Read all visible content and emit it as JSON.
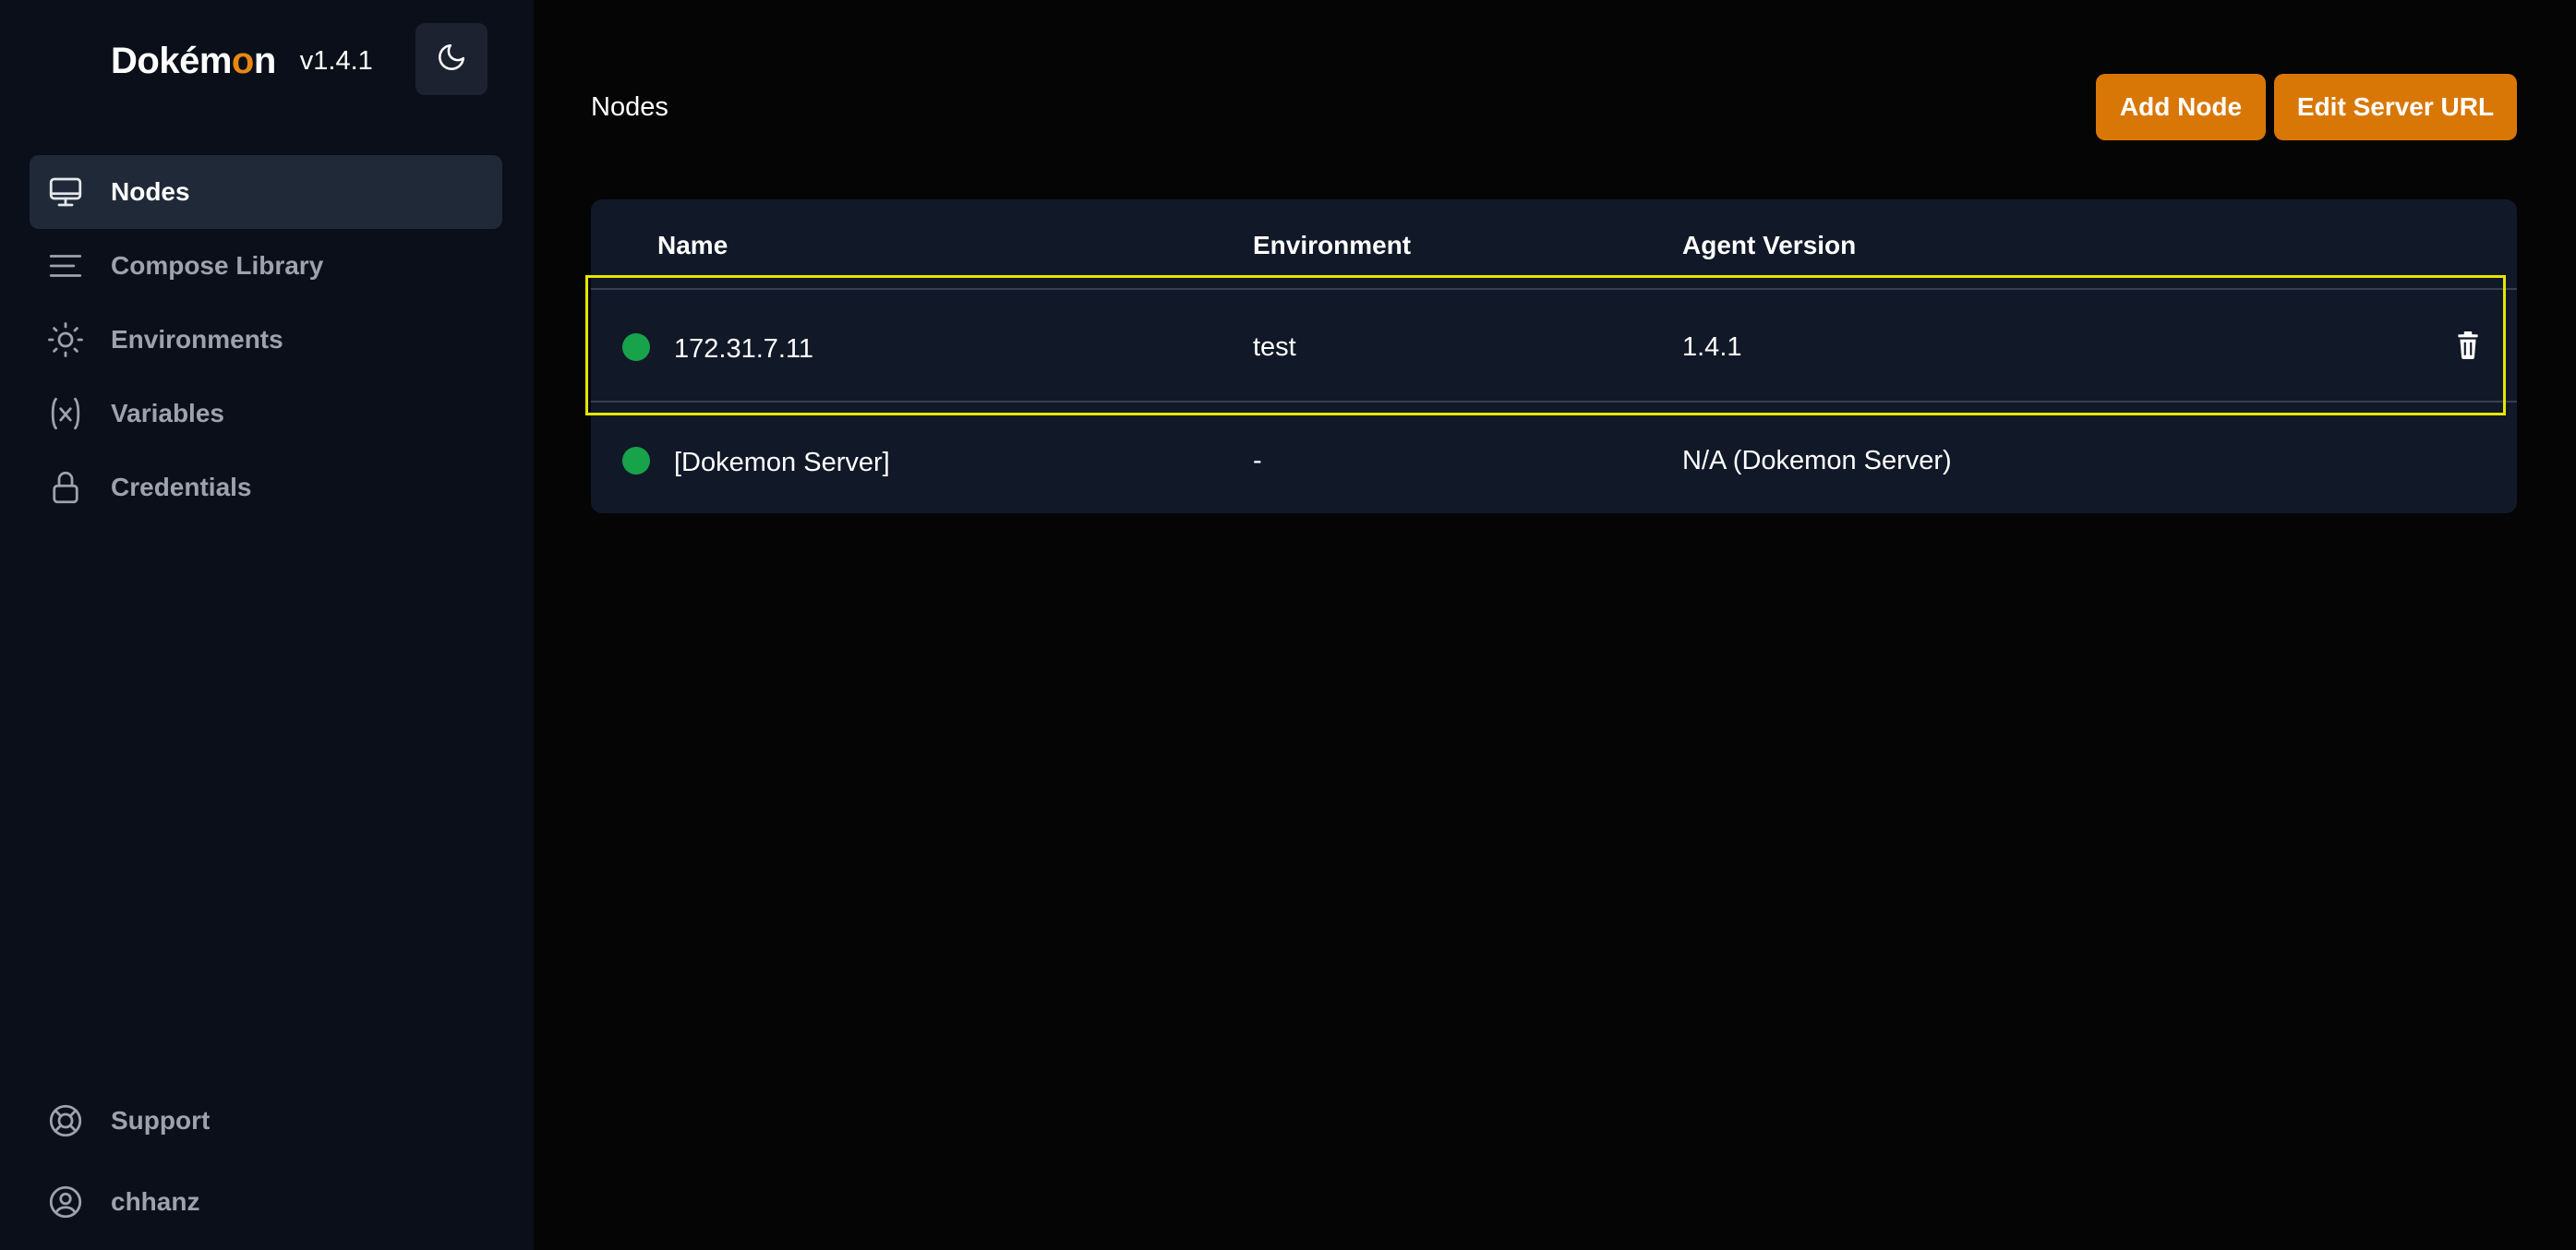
{
  "app": {
    "brand_prefix": "Dok",
    "brand_accent_char": "é",
    "brand_mid": "m",
    "brand_accent_o": "o",
    "brand_suffix": "n",
    "version": "v1.4.1"
  },
  "theme_toggle": {
    "icon": "moon-icon"
  },
  "sidebar": {
    "items": [
      {
        "label": "Nodes",
        "icon": "monitor-icon",
        "active": true
      },
      {
        "label": "Compose Library",
        "icon": "lines-icon",
        "active": false
      },
      {
        "label": "Environments",
        "icon": "sun-icon",
        "active": false
      },
      {
        "label": "Variables",
        "icon": "function-x-icon",
        "active": false
      },
      {
        "label": "Credentials",
        "icon": "lock-icon",
        "active": false
      }
    ],
    "bottom_items": [
      {
        "label": "Support",
        "icon": "lifebuoy-icon"
      },
      {
        "label": "chhanz",
        "icon": "user-circle-icon"
      }
    ]
  },
  "main": {
    "title": "Nodes",
    "buttons": {
      "add_node": "Add Node",
      "edit_server_url": "Edit Server URL"
    },
    "table": {
      "columns": [
        "Name",
        "Environment",
        "Agent Version"
      ],
      "rows": [
        {
          "name": "172.31.7.11",
          "environment": "test",
          "agent_version": "1.4.1",
          "status": "online",
          "deletable": true
        },
        {
          "name": "[Dokemon Server]",
          "environment": "-",
          "agent_version": "N/A (Dokemon Server)",
          "status": "online",
          "deletable": false
        }
      ]
    }
  },
  "colors": {
    "accent": "#d97706",
    "sidebar_bg": "#0b0f19",
    "card_bg": "#111827",
    "status_online": "#16a34a",
    "highlight": "#e6e600"
  }
}
